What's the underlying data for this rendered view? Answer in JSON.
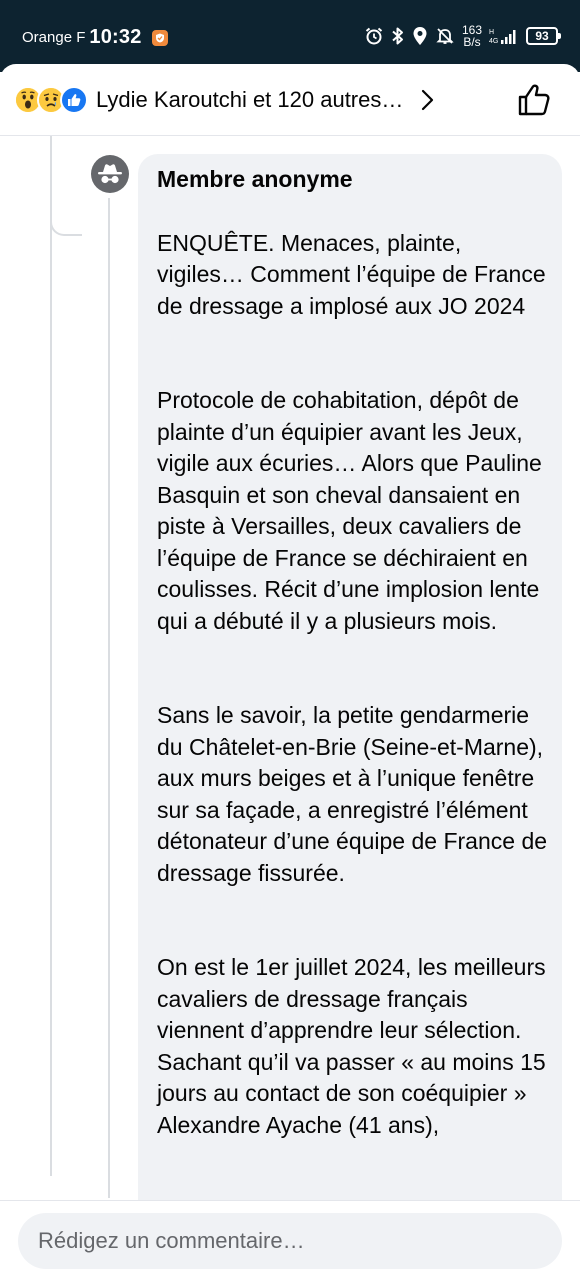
{
  "status_bar": {
    "carrier": "Orange F",
    "time": "10:32",
    "net_speed_value": "163",
    "net_speed_unit": "B/s",
    "battery": "93"
  },
  "header": {
    "reactors_text": "Lydie Karoutchi et 120 autres…",
    "reaction_icons": [
      "wow-icon",
      "sad-icon",
      "like-icon"
    ]
  },
  "comment": {
    "author": "Membre anonyme",
    "paragraphs": [
      "ENQUÊTE. Menaces, plainte, vigiles… Comment l’équipe de France de dressage a implosé aux JO 2024",
      "Protocole de cohabitation, dépôt de plainte d’un équipier avant les Jeux, vigile aux écuries… Alors que Pauline Basquin et son cheval dansaient en piste à Versailles, deux cavaliers de l’équipe de France se déchiraient en coulisses. Récit d’une implosion lente qui a débuté il y a plusieurs mois.",
      "Sans le savoir, la petite gendarmerie du Châtelet-en-Brie (Seine-et-Marne), aux murs beiges et à l’unique fenêtre sur sa façade, a enregistré l’élément détonateur d’une équipe de France de dressage fissurée.",
      "On est le 1er juillet 2024, les meilleurs cavaliers de dressage français viennent d’apprendre leur sélection. Sachant qu’il va passer « au moins 15 jours au contact de son coéquipier » Alexandre Ayache (41 ans),"
    ]
  },
  "composer": {
    "placeholder": "Rédigez un commentaire…"
  },
  "colors": {
    "status_bar_bg": "#0d2330",
    "bubble_bg": "#f0f2f5",
    "like_blue": "#1877f2"
  }
}
